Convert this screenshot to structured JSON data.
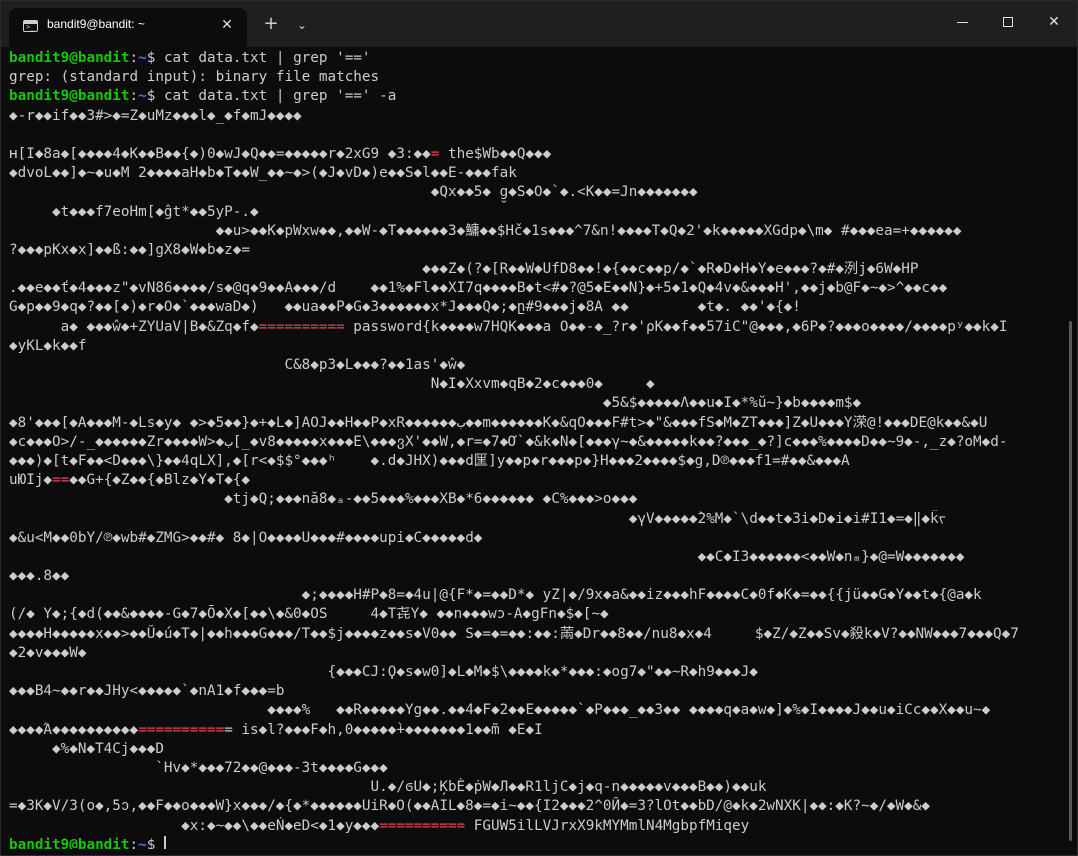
{
  "window": {
    "tab_title": "bandit9@bandit: ~",
    "tab_icon": "terminal-icon",
    "close_tab": "✕",
    "new_tab": "+",
    "dropdown": "⌄",
    "close_window": "✕"
  },
  "prompt": {
    "user_host": "bandit9@bandit",
    "sep": ":",
    "path": "~",
    "dollar": "$ "
  },
  "cmd1": "cat data.txt | grep '=='",
  "grep_msg": "grep: (standard input): binary file matches",
  "cmd2": "cat data.txt | grep '==' -a",
  "output": [
    {
      "t": "◆-r◆◆if◆◆3#>◆=Z◆uMz◆◆◆l◆_◆f◆mJ◆◆◆◆"
    },
    {
      "t": ""
    },
    {
      "t": "ʜ[I◆8a◆[◆◆◆◆4◆K◆◆B◆◆{◆)0◆wJ◆Q◆◆=◆◆◆◆◆r◆2xG9 ◆3:◆◆",
      "h": "=",
      "a": " the$Wb◆◆Q◆◆◆"
    },
    {
      "t": "◆dvoL◆◆]◆~◆u◆M 2◆◆◆◆aH◆b◆T◆◆W_◆◆~◆>(◆J◆vD◆)e◆◆S◆l◆◆E-◆◆◆fak"
    },
    {
      "t": "                                                 ◆Qx◆◆5◆ g̮◆S◆O◆`◆.<K◆◆=Jn◆◆◆◆◆◆◆"
    },
    {
      "t": "     ◆t◆◆◆f7eoHm[◆ĝt*◆◆5yP-.◆"
    },
    {
      "t": "                        ◆◆u>◆◆K◆pWxw◆◆,◆◆W-◆T◆◆◆◆◆◆3◆鱅◆◆$Hč◆1s◆◆◆^7&n!◆◆◆◆T◆Q◆2'◆k◆◆◆◆◆XGdp◆\\m◆ #◆◆◆ea=+◆◆◆◆◆◆"
    },
    {
      "t": "?◆◆◆pKx◆x]◆◆ß:◆◆]gX8◆W◆b◆z◆="
    },
    {
      "t": "                                                ◆◆◆Z◆(?◆[R◆◆W◆UfD8◆◆!◆{◆◆c◆◆p/◆`◆R◆D◆H◆Y◆e◆◆◆?◆#◆洌j◆6W◆HP"
    },
    {
      "t": ".◆◆e◆◆ť◆4◆◆◆z\"◆vN86◆◆◆◆/s◆@q◆9◆◆A◆◆◆/d    ◆◆1%◆Fl◆◆XI7q◆◆◆◆B◆t<#◆?@5◆E◆◆N}◆+5◆1◆Q◆4v◆&◆◆◆H',◆◆j◆b@F◆~◆>^◆◆c◆◆"
    },
    {
      "t": "G◆p◆◆9◆q◆?◆◆[◆)◆r◆O◆`◆◆◆waD◆)   ◆◆ua◆◆P◆G◆3◆◆◆◆◆◆x*J◆◆◆Q◆;◆ը#9◆◆◆j◆8A ◆◆        ◆t◆. ◆◆'◆{◆!"
    },
    {
      "t": "      a◆ ◆◆◆ŵ◆+ZYUaV|B◆&Zq◆f◆",
      "h": "==========",
      "a": " password{k◆◆◆◆w7HQK◆◆◆a O◆◆-◆_?r◆'ρK◆◆f◆◆57iC\"@◆◆◆,◆6P◆?◆◆◆o◆◆◆◆/◆◆◆◆pʸ◆◆k◆I"
    },
    {
      "t": "◆yKL◆k◆◆f"
    },
    {
      "t": "                                C&8◆p3◆L◆◆◆?◆◆1as'◆ŵ◆"
    },
    {
      "t": "                                                 N◆I◆Xxvm◆qB◆2◆c◆◆◆0◆     ◆"
    },
    {
      "t": "                                                                     ◆5&$◆◆◆◆◆Λ◆◆u◆I◆*%ŭ~}◆b◆◆◆◆m$◆"
    },
    {
      "t": "◆8'◆◆◆[◆A◆◆◆M-◆Ls◆y◆ ◆>◆5◆◆}◆+◆L◆]AOJ◆◆H◆◆P◆xR◆◆◆◆◆◆ب◆◆m◆◆◆◆◆◆K◆&qO◆◆◆F#t>◆\"&◆◆◆fS◆M◆ZT◆◆◆]Z◆U◆◆◆Y溁@!◆◆◆DE@k◆◆&◆U"
    },
    {
      "t": "◆c◆◆◆O>/-_◆◆◆◆◆◆Zr◆◆◆◆W>◆ب[_◆v8◆◆◆◆◆x◆◆◆E\\◆◆◆ვX'◆◆W,◆r=◆7◆Ơ`◆&k◆N◆[◆◆◆γ~◆&◆◆◆◆◆k◆◆?◆◆◆_◆?]c◆◆◆%◆◆◆◆D◆◆~9◆-,_z◆?oM◆d-"
    },
    {
      "t": "◆◆◆)◆[t◆F◆◆<D◆◆◆\\}◆◆4qLX],◆[r<◆$$°◆◆◆ʰ    ◆.d◆JHX)◆◆◆d匩]y◆◆p◆r◆◆◆p◆}H◆◆◆2◆◆◆◆$◆g,D℗◆◆◆f1=#◆◆&◆◆◆A"
    },
    {
      "t": "uЮIj◆",
      "h": "==",
      "a": "◆◆G+{◆Z◆◆{◆Blz◆Y◆T◆{◆"
    },
    {
      "t": "                         ◆tj◆Q;◆◆◆nă8◆ₐ-◆◆5◆◆◆%◆◆◆XB◆*6◆◆◆◆◆◆ ◆C%◆◆◆>o◆◆◆"
    },
    {
      "t": "                                                                        ◆γV◆◆◆◆◆̀2%M◆`\\d◆◆t◆3i◆D◆i◆i#I1◆=◆‖◆k̂ᡕ"
    },
    {
      "t": "◆&u<M◆◆0bY/℗◆wb#◆ZMG>◆◆#◆ 8◆|O◆◆◆◆U◆◆◆#◆◆◆◆upi◆C◆◆◆◆◆d◆"
    },
    {
      "t": "                                                                                ◆◆C◆I3◆◆◆◆◆◆<◆◆W◆nₘ}◆@=W◆◆◆◆◆◆◆"
    },
    {
      "t": "◆◆◆.8◆◆"
    },
    {
      "t": "                                  ◆;◆◆◆◆H#P◆8=◆4u|@{F*◆=◆◆D*◆ yZ|◆/9x◆a&◆◆iz◆◆◆hF◆◆◆◆C◆0f◆K◆=◆◆{{jü◆◆G◆Y◆◆t◆{@a◆k"
    },
    {
      "t": "(/◆ Y◆;{◆d(◆◆&◆◆◆◆-G◆7◆Ō◆X◆[◆◆\\◆&0◆OS     4◆T㐂Y◆ ◆◆n◆◆◆wɔ-A◆gFn◆$◆[~◆"
    },
    {
      "t": "◆◆◆◆H◆◆◆◆◆x◆◆>◆◆Ŭ◆ú◆T◆|◆◆h◆◆◆G◆◆◆/T◆◆$j◆◆◆◆z◆◆s◆V0◆◆ S◆=◆=◆◆:◆◆:䓣◆Dr◆◆8◆◆/nu8◆x◆4     $◆Z/◆Z◆◆Sv◆殺k◆V?◆◆NW◆◆◆7◆◆◆Q◆7"
    },
    {
      "t": "◆2◆v◆◆◆W◆"
    },
    {
      "t": "                                     {◆◆◆CJ:Ϙ◆s◆w0]◆L◆M◆$\\◆◆◆◆k◆*◆◆◆:◆og7◆\"◆◆~R◆h9◆◆◆J◆"
    },
    {
      "t": "◆◆◆B4~◆◆r◆◆JHy<◆◆◆◆◆`◆nA1◆f◆◆◆=b"
    },
    {
      "t": "                              ◆◆◆◆%   ◆◆R◆◆◆◆◆Yg◆◆.◆◆4◆F◆2◆◆E◆◆◆◆◆`◆P◆◆◆_◆◆3◆◆ ◆◆◆◆q◆a◆w◆]◆%◆I◆◆◆◆J◆◆u◆iCc◆◆X◆◆u~◆"
    },
    {
      "t": "◆◆◆◆Ά◆◆◆◆◆◆◆◆◆◆",
      "h": "==========",
      "a": "= is◆l?◆◆◆F◆h,0◆◆◆◆◆̀+◆◆◆◆◆◆◆1◆◆m̃ ◆E◆I"
    },
    {
      "t": "     ◆%◆N◆T4Cj◆◆◆D"
    },
    {
      "t": "                 `Hv◆*◆◆◆72◆◆@◆◆◆-3t◆◆◆◆G◆◆◆"
    },
    {
      "t": "                                          U.◆/ϭU◆;ĶbÈ◆ṗW◆Л◆◆R1ljC◆j◆q-n◆◆◆◆◆v◆◆◆B◆◆)◆◆uk"
    },
    {
      "t": "=◆3K◆V/3(o◆,5ↄ,◆◆F◆◆o◆◆◆W}x◆◆◆/◆{◆*◆◆◆◆◆◆UiR◆O(◆◆AIL◆8◆=◆i~◆◆{I2◆◆◆2^0Й◆=3?lOt◆◆bD/@◆k◆2wNXK|◆◆:◆K?~◆/◆W◆&◆"
    },
    {
      "t": "                    ◆x:◆~◆◆\\◆◆eŃ◆eD<◆1◆y◆◆◆",
      "h": "==========",
      "a": " FGUW5ilLVJrxX9kMYMmlN4MgbpfMiqey"
    }
  ],
  "colors": {
    "prompt": "#16c60c",
    "path": "#3b78ff",
    "match": "#e74856",
    "text": "#cccccc",
    "background": "#0c0c0c"
  }
}
